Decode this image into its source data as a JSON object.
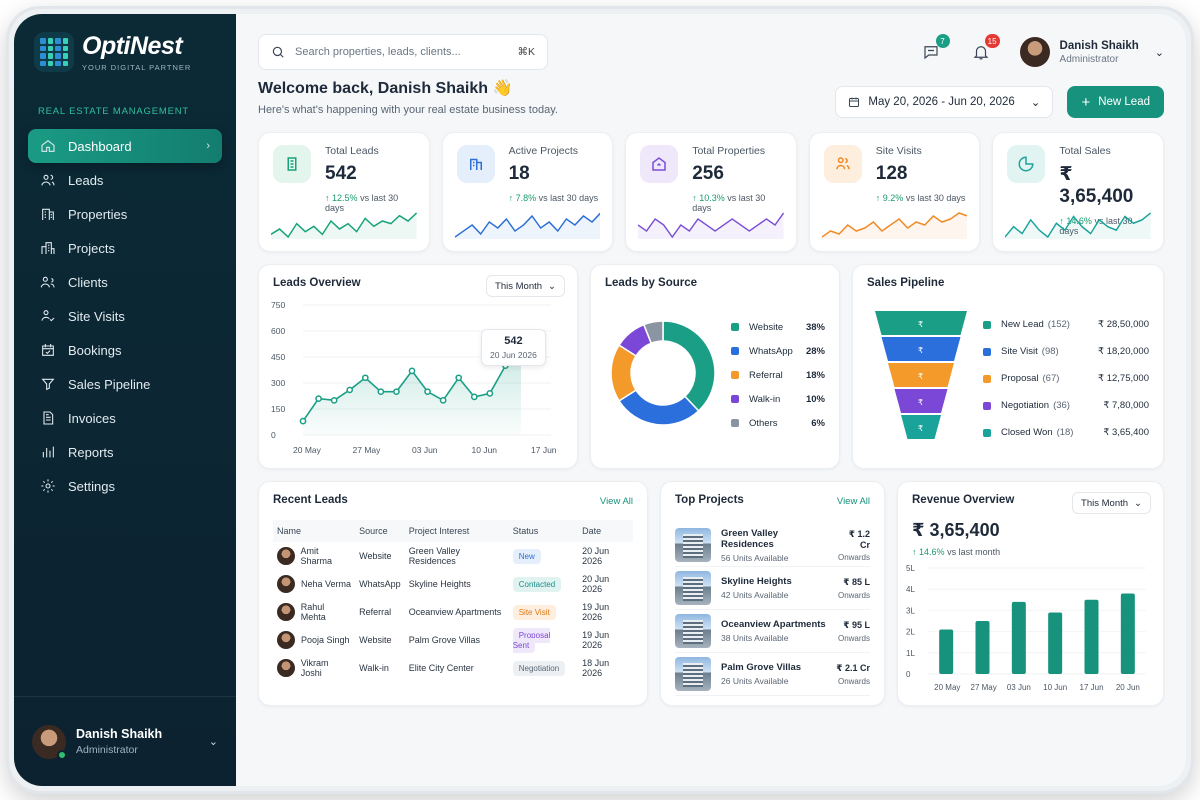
{
  "brand": {
    "name": "OptiNest",
    "tagline": "YOUR DIGITAL PARTNER"
  },
  "sidebar": {
    "section_label": "REAL ESTATE MANAGEMENT",
    "items": [
      {
        "label": "Dashboard",
        "icon": "home-icon",
        "active": true
      },
      {
        "label": "Leads",
        "icon": "users-icon"
      },
      {
        "label": "Properties",
        "icon": "building-icon"
      },
      {
        "label": "Projects",
        "icon": "city-icon"
      },
      {
        "label": "Clients",
        "icon": "clients-icon"
      },
      {
        "label": "Site Visits",
        "icon": "visit-icon"
      },
      {
        "label": "Bookings",
        "icon": "calendar-icon"
      },
      {
        "label": "Sales Pipeline",
        "icon": "pipeline-icon"
      },
      {
        "label": "Invoices",
        "icon": "invoice-icon"
      },
      {
        "label": "Reports",
        "icon": "bar-chart-icon"
      },
      {
        "label": "Settings",
        "icon": "gear-icon"
      }
    ],
    "user": {
      "name": "Danish Shaikh",
      "role": "Administrator"
    }
  },
  "topbar": {
    "search_placeholder": "Search properties, leads, clients...",
    "search_shortcut": "⌘K",
    "messages_badge": "7",
    "notifications_badge": "15",
    "user": {
      "name": "Danish Shaikh",
      "role": "Administrator"
    }
  },
  "welcome": {
    "title": "Welcome back, Danish Shaikh 👋",
    "subtitle": "Here's what's happening with your real estate business today.",
    "date_range": "May 20, 2026 - Jun 20, 2026",
    "new_lead_label": "New Lead"
  },
  "kpis": [
    {
      "label": "Total Leads",
      "value": "542",
      "delta": "12.5%",
      "delta_note": "vs last 30 days",
      "color": "#17a37a",
      "bg": "#e4f5ee"
    },
    {
      "label": "Active Projects",
      "value": "18",
      "delta": "7.8%",
      "delta_note": "vs last 30 days",
      "color": "#2c6fd6",
      "bg": "#e5effb"
    },
    {
      "label": "Total Properties",
      "value": "256",
      "delta": "10.3%",
      "delta_note": "vs last 30 days",
      "color": "#7a4fd6",
      "bg": "#efe8fb"
    },
    {
      "label": "Site Visits",
      "value": "128",
      "delta": "9.2%",
      "delta_note": "vs last 30 days",
      "color": "#f08a24",
      "bg": "#fdeedd"
    },
    {
      "label": "Total Sales",
      "value": "₹ 3,65,400",
      "delta": "14.6%",
      "delta_note": "vs last 30 days",
      "color": "#1aa39a",
      "bg": "#e1f4f2"
    }
  ],
  "leads_overview": {
    "title": "Leads Overview",
    "period": "This Month",
    "tooltip_value": "542",
    "tooltip_date": "20 Jun 2026"
  },
  "leads_by_source": {
    "title": "Leads by Source",
    "items": [
      {
        "label": "Website",
        "pct": "38%",
        "color": "#1a9f86"
      },
      {
        "label": "WhatsApp",
        "pct": "28%",
        "color": "#2b6fdc"
      },
      {
        "label": "Referral",
        "pct": "18%",
        "color": "#f39a2b"
      },
      {
        "label": "Walk-in",
        "pct": "10%",
        "color": "#7b47d6"
      },
      {
        "label": "Others",
        "pct": "6%",
        "color": "#8b94a3"
      }
    ]
  },
  "sales_pipeline": {
    "title": "Sales Pipeline",
    "stages": [
      {
        "label": "New Lead",
        "count": "(152)",
        "amount": "₹ 28,50,000",
        "color": "#1a9f86"
      },
      {
        "label": "Site Visit",
        "count": "(98)",
        "amount": "₹ 18,20,000",
        "color": "#2b6fdc"
      },
      {
        "label": "Proposal",
        "count": "(67)",
        "amount": "₹ 12,75,000",
        "color": "#f39a2b"
      },
      {
        "label": "Negotiation",
        "count": "(36)",
        "amount": "₹ 7,80,000",
        "color": "#7b47d6"
      },
      {
        "label": "Closed Won",
        "count": "(18)",
        "amount": "₹ 3,65,400",
        "color": "#1aa39a"
      }
    ]
  },
  "recent_leads": {
    "title": "Recent Leads",
    "view_all": "View All",
    "columns": [
      "Name",
      "Source",
      "Project Interest",
      "Status",
      "Date"
    ],
    "rows": [
      {
        "name": "Amit Sharma",
        "source": "Website",
        "project": "Green Valley Residences",
        "status": "New",
        "status_color": "#2b6fdc",
        "status_bg": "#e5effb",
        "date": "20 Jun 2026"
      },
      {
        "name": "Neha Verma",
        "source": "WhatsApp",
        "project": "Skyline Heights",
        "status": "Contacted",
        "status_color": "#1a8f8a",
        "status_bg": "#e0f3f1",
        "date": "20 Jun 2026"
      },
      {
        "name": "Rahul Mehta",
        "source": "Referral",
        "project": "Oceanview Apartments",
        "status": "Site Visit",
        "status_color": "#e07b18",
        "status_bg": "#fdeedd",
        "date": "19 Jun 2026"
      },
      {
        "name": "Pooja Singh",
        "source": "Website",
        "project": "Palm Grove Villas",
        "status": "Proposal Sent",
        "status_color": "#7b47d6",
        "status_bg": "#efe8fb",
        "date": "19 Jun 2026"
      },
      {
        "name": "Vikram Joshi",
        "source": "Walk-in",
        "project": "Elite City Center",
        "status": "Negotiation",
        "status_color": "#5a6674",
        "status_bg": "#eceff3",
        "date": "18 Jun 2026"
      }
    ]
  },
  "top_projects": {
    "title": "Top Projects",
    "view_all": "View All",
    "items": [
      {
        "name": "Green Valley Residences",
        "units": "56 Units Available",
        "price": "₹ 1.2 Cr",
        "note": "Onwards"
      },
      {
        "name": "Skyline Heights",
        "units": "42 Units Available",
        "price": "₹ 85 L",
        "note": "Onwards"
      },
      {
        "name": "Oceanview Apartments",
        "units": "38 Units Available",
        "price": "₹ 95 L",
        "note": "Onwards"
      },
      {
        "name": "Palm Grove Villas",
        "units": "26 Units Available",
        "price": "₹ 2.1 Cr",
        "note": "Onwards"
      }
    ]
  },
  "revenue_overview": {
    "title": "Revenue Overview",
    "period": "This Month",
    "value": "₹ 3,65,400",
    "delta": "14.6%",
    "delta_note": "vs last month"
  },
  "chart_data": [
    {
      "type": "line",
      "title": "Leads Overview",
      "x_ticks": [
        "20 May",
        "27 May",
        "03 Jun",
        "10 Jun",
        "17 Jun"
      ],
      "y_ticks": [
        0,
        150,
        300,
        450,
        600,
        750
      ],
      "ylim": [
        0,
        750
      ],
      "values": [
        80,
        210,
        200,
        260,
        330,
        250,
        250,
        370,
        250,
        200,
        330,
        220,
        240,
        400,
        542
      ],
      "color": "#1a9f86"
    },
    {
      "type": "pie",
      "title": "Leads by Source",
      "labels": [
        "Website",
        "WhatsApp",
        "Referral",
        "Walk-in",
        "Others"
      ],
      "values": [
        38,
        28,
        18,
        10,
        6
      ]
    },
    {
      "type": "bar",
      "title": "Revenue Overview",
      "categories": [
        "20 May",
        "27 May",
        "03 Jun",
        "10 Jun",
        "17 Jun",
        "20 Jun"
      ],
      "values": [
        2.1,
        2.5,
        3.4,
        2.9,
        3.5,
        3.8
      ],
      "y_ticks": [
        "0",
        "1L",
        "2L",
        "3L",
        "4L",
        "5L"
      ],
      "ylim": [
        0,
        5
      ],
      "color": "#17937d"
    }
  ],
  "sparklines": [
    [
      10,
      12,
      9,
      14,
      11,
      13,
      10,
      15,
      12,
      14,
      11,
      16,
      13,
      15,
      14,
      17,
      15,
      18
    ],
    [
      9,
      11,
      13,
      10,
      14,
      12,
      15,
      11,
      13,
      16,
      12,
      14,
      11,
      15,
      13,
      16,
      14,
      17
    ],
    [
      12,
      11,
      13,
      12,
      10,
      12,
      11,
      13,
      12,
      11,
      12,
      13,
      12,
      11,
      12,
      13,
      12,
      14
    ],
    [
      8,
      10,
      9,
      12,
      10,
      11,
      13,
      10,
      12,
      14,
      11,
      13,
      12,
      15,
      13,
      14,
      16,
      15
    ],
    [
      10,
      13,
      11,
      15,
      12,
      10,
      14,
      12,
      16,
      13,
      11,
      15,
      13,
      12,
      16,
      14,
      15,
      17
    ]
  ]
}
